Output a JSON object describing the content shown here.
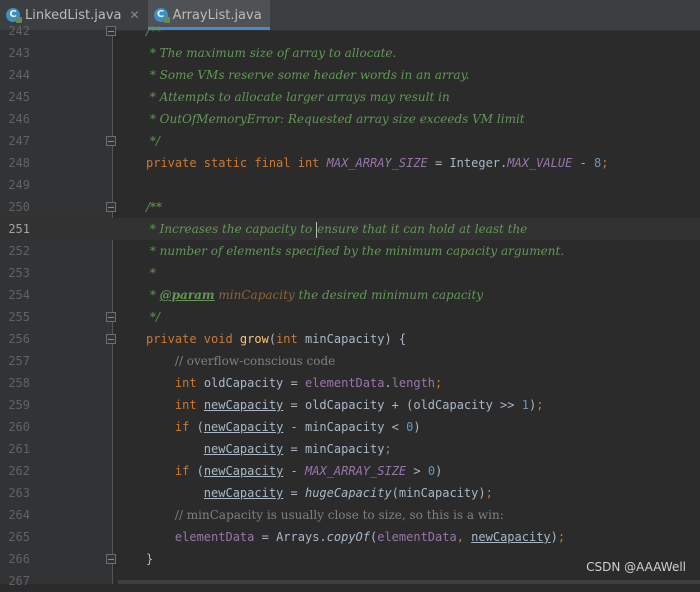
{
  "tabs": [
    {
      "label": "LinkedList.java",
      "active": false,
      "close": "✕"
    },
    {
      "label": "ArrayList.java",
      "active": true,
      "close": "✕"
    }
  ],
  "watermark": "CSDN @AAAWell",
  "current_line": "251",
  "lines": [
    {
      "n": "242",
      "fold": true,
      "tokens": [
        [
          "cmt",
          "/**"
        ]
      ]
    },
    {
      "n": "243",
      "fold": false,
      "tokens": [
        [
          "cmt",
          " * The maximum size of array to allocate."
        ]
      ]
    },
    {
      "n": "244",
      "fold": false,
      "tokens": [
        [
          "cmt",
          " * Some VMs reserve some header words in an array."
        ]
      ]
    },
    {
      "n": "245",
      "fold": false,
      "tokens": [
        [
          "cmt",
          " * Attempts to allocate larger arrays may result in"
        ]
      ]
    },
    {
      "n": "246",
      "fold": false,
      "tokens": [
        [
          "cmt",
          " * OutOfMemoryError: Requested array size exceeds VM limit"
        ]
      ]
    },
    {
      "n": "247",
      "fold": true,
      "tokens": [
        [
          "cmt",
          " */"
        ]
      ]
    },
    {
      "n": "248",
      "fold": false,
      "tokens": [
        [
          "kw",
          "private static final int "
        ],
        [
          "sfld",
          "MAX_ARRAY_SIZE"
        ],
        [
          "txt",
          " = Integer."
        ],
        [
          "sfld",
          "MAX_VALUE"
        ],
        [
          "txt",
          " - "
        ],
        [
          "num",
          "8"
        ],
        [
          "kw",
          ";"
        ]
      ]
    },
    {
      "n": "249",
      "fold": false,
      "tokens": []
    },
    {
      "n": "250",
      "fold": true,
      "tokens": [
        [
          "cmt",
          "/**"
        ]
      ]
    },
    {
      "n": "251",
      "fold": false,
      "tokens": [
        [
          "cmt",
          " * Increases the capacity to "
        ],
        [
          "caret",
          ""
        ],
        [
          "cmt",
          "ensure that it can hold at least the"
        ]
      ]
    },
    {
      "n": "252",
      "fold": false,
      "tokens": [
        [
          "cmt",
          " * number of elements specified by the minimum capacity argument."
        ]
      ]
    },
    {
      "n": "253",
      "fold": false,
      "tokens": [
        [
          "cmt",
          " *"
        ]
      ]
    },
    {
      "n": "254",
      "fold": false,
      "tokens": [
        [
          "cmt",
          " * "
        ],
        [
          "tag",
          "@param"
        ],
        [
          "tagv",
          " minCapacity"
        ],
        [
          "cmt",
          " the desired minimum capacity"
        ]
      ]
    },
    {
      "n": "255",
      "fold": true,
      "tokens": [
        [
          "cmt",
          " */"
        ]
      ]
    },
    {
      "n": "256",
      "fold": true,
      "tokens": [
        [
          "kw",
          "private void "
        ],
        [
          "mth",
          "grow"
        ],
        [
          "txt",
          "("
        ],
        [
          "kw",
          "int "
        ],
        [
          "txt",
          "minCapacity) {"
        ]
      ]
    },
    {
      "n": "257",
      "fold": false,
      "tokens": [
        [
          "txt",
          "    "
        ],
        [
          "lc",
          "// overflow-conscious code"
        ]
      ]
    },
    {
      "n": "258",
      "fold": false,
      "tokens": [
        [
          "txt",
          "    "
        ],
        [
          "kw",
          "int "
        ],
        [
          "txt",
          "oldCapacity = "
        ],
        [
          "fld",
          "elementData"
        ],
        [
          "txt",
          "."
        ],
        [
          "fld",
          "length"
        ],
        [
          "kw",
          ";"
        ]
      ]
    },
    {
      "n": "259",
      "fold": false,
      "tokens": [
        [
          "txt",
          "    "
        ],
        [
          "kw",
          "int "
        ],
        [
          "ul",
          "newCapacity"
        ],
        [
          "txt",
          " = oldCapacity + (oldCapacity >> "
        ],
        [
          "num",
          "1"
        ],
        [
          "txt",
          ")"
        ],
        [
          "kw",
          ";"
        ]
      ]
    },
    {
      "n": "260",
      "fold": false,
      "tokens": [
        [
          "txt",
          "    "
        ],
        [
          "kw",
          "if "
        ],
        [
          "txt",
          "("
        ],
        [
          "ul",
          "newCapacity"
        ],
        [
          "txt",
          " - minCapacity < "
        ],
        [
          "num",
          "0"
        ],
        [
          "txt",
          ")"
        ]
      ]
    },
    {
      "n": "261",
      "fold": false,
      "tokens": [
        [
          "txt",
          "        "
        ],
        [
          "ul",
          "newCapacity"
        ],
        [
          "txt",
          " = minCapacity"
        ],
        [
          "kw",
          ";"
        ]
      ]
    },
    {
      "n": "262",
      "fold": false,
      "tokens": [
        [
          "txt",
          "    "
        ],
        [
          "kw",
          "if "
        ],
        [
          "txt",
          "("
        ],
        [
          "ul",
          "newCapacity"
        ],
        [
          "txt",
          " - "
        ],
        [
          "sfld",
          "MAX_ARRAY_SIZE"
        ],
        [
          "txt",
          " > "
        ],
        [
          "num",
          "0"
        ],
        [
          "txt",
          ")"
        ]
      ]
    },
    {
      "n": "263",
      "fold": false,
      "tokens": [
        [
          "txt",
          "        "
        ],
        [
          "ul",
          "newCapacity"
        ],
        [
          "txt",
          " = "
        ],
        [
          "smth",
          "hugeCapacity"
        ],
        [
          "txt",
          "(minCapacity)"
        ],
        [
          "kw",
          ";"
        ]
      ]
    },
    {
      "n": "264",
      "fold": false,
      "tokens": [
        [
          "txt",
          "    "
        ],
        [
          "lc",
          "// minCapacity is usually close to size, so this is a win:"
        ]
      ]
    },
    {
      "n": "265",
      "fold": false,
      "tokens": [
        [
          "txt",
          "    "
        ],
        [
          "fld",
          "elementData"
        ],
        [
          "txt",
          " = Arrays."
        ],
        [
          "smth",
          "copyOf"
        ],
        [
          "txt",
          "("
        ],
        [
          "fld",
          "elementData"
        ],
        [
          "kw",
          ", "
        ],
        [
          "ul",
          "newCapacity"
        ],
        [
          "txt",
          ")"
        ],
        [
          "kw",
          ";"
        ]
      ]
    },
    {
      "n": "266",
      "fold": true,
      "tokens": [
        [
          "txt",
          "}"
        ]
      ]
    },
    {
      "n": "267",
      "fold": false,
      "tokens": []
    }
  ]
}
